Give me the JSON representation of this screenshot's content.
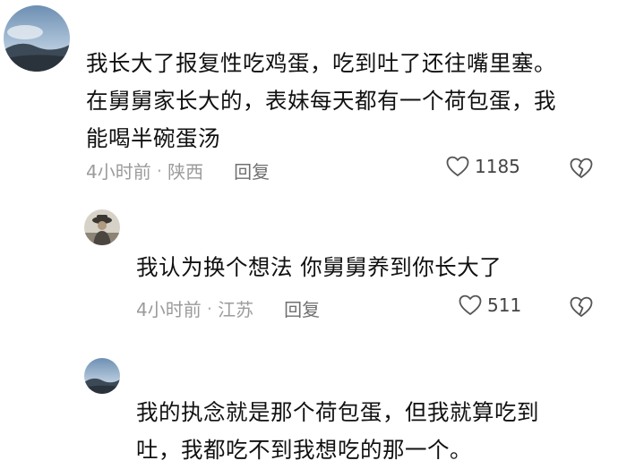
{
  "comments": [
    {
      "lines": [
        "我长大了报复性吃鸡蛋，吃到吐了还往嘴里塞。",
        "在舅舅家长大的，表妹每天都有一个荷包蛋，我",
        "能喝半碗蛋汤"
      ],
      "time": "4小时前",
      "location": "陕西",
      "reply_label": "回复",
      "likes": "1185"
    },
    {
      "lines": [
        "我认为换个想法 你舅舅养到你长大了"
      ],
      "time": "4小时前",
      "location": "江苏",
      "reply_label": "回复",
      "likes": "511"
    },
    {
      "lines": [
        "我的执念就是那个荷包蛋，但我就算吃到",
        "吐，我都吃不到我想吃的那一个。"
      ]
    }
  ],
  "separator": "·",
  "icons": {
    "like": "heart-outline-icon",
    "dislike": "broken-heart-icon"
  },
  "colors": {
    "meta_text": "#9b9b9b",
    "body_text": "#111111"
  }
}
